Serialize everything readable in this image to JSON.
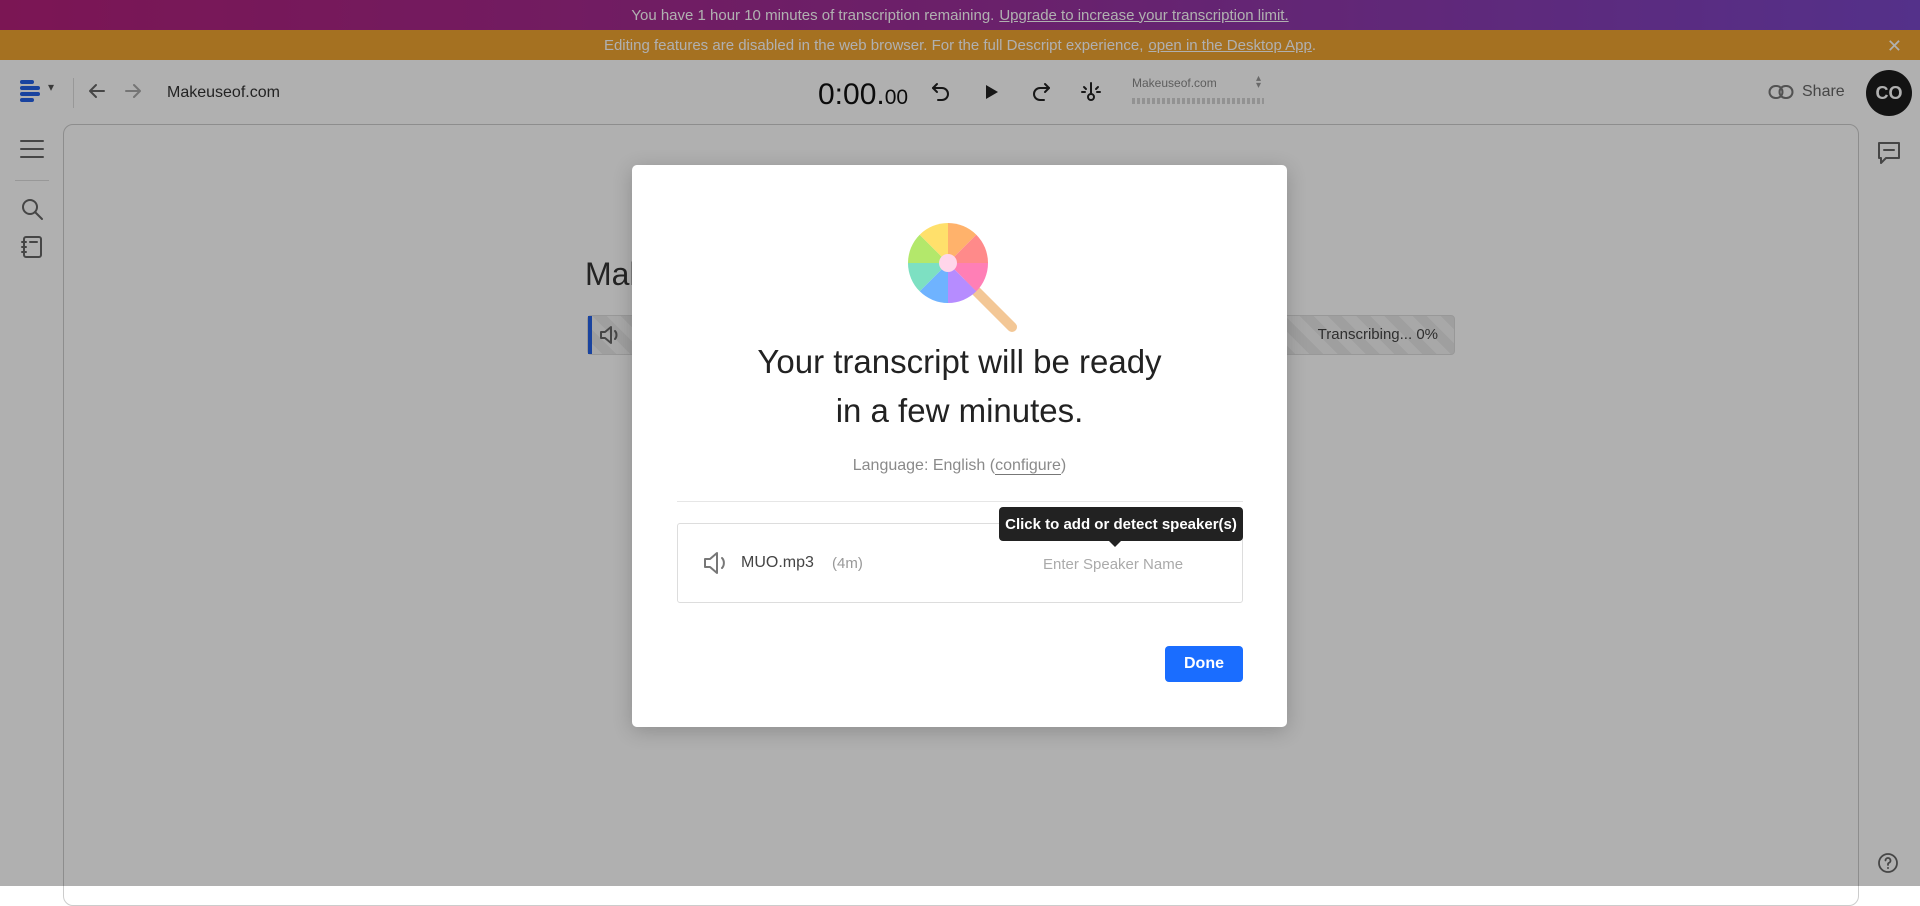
{
  "banners": {
    "transcription": {
      "text": "You have 1 hour 10 minutes of transcription remaining.",
      "link": "Upgrade to increase your transcription limit.",
      "gradient_start": "#b3207a",
      "gradient_end": "#7a47c8"
    },
    "editing": {
      "text": "Editing features are disabled in the web browser. For the full Descript experience,",
      "link": "open in the Desktop App",
      "suffix": ".",
      "close_icon": "✕",
      "color": "#f0a431"
    }
  },
  "toolbar": {
    "project_title": "Makeuseof.com",
    "time_main": "0:00.",
    "time_frac": "00",
    "composition": "Makeuseof.com",
    "share_label": "Share",
    "avatar_initials": "CO"
  },
  "editor": {
    "doc_title": "Makeuseof.com",
    "track_status": "Transcribing...   0%"
  },
  "modal": {
    "headline_line1": "Your transcript will be ready",
    "headline_line2": "in a few minutes.",
    "language_prefix": "Language: English (",
    "language_link": "configure",
    "language_suffix": ")",
    "tooltip": "Click to add or detect speaker(s)",
    "file_name": "MUO.mp3",
    "file_duration": "(4m)",
    "speaker_placeholder": "Enter Speaker Name",
    "done_label": "Done",
    "accent": "#1a6dff"
  },
  "icons": {
    "logo": "descript-logo-icon",
    "back": "arrow-left-icon",
    "forward": "arrow-right-icon",
    "rewind": "rewind-icon",
    "play": "play-icon",
    "forward_skip": "skip-forward-icon",
    "pin": "pin-icon",
    "share": "link-icon",
    "menu": "menu-icon",
    "search": "search-icon",
    "notebook": "notebook-icon",
    "comment": "comment-icon",
    "help": "help-icon",
    "speaker": "speaker-icon",
    "lollipop": "lollipop-icon"
  }
}
